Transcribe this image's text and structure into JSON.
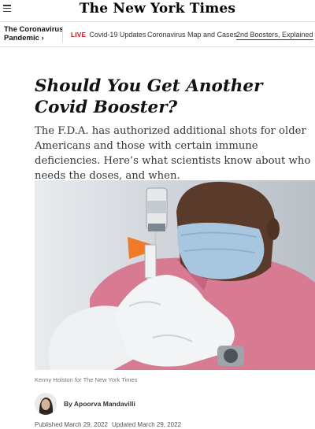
{
  "header": {
    "logo_text": "The New York Times",
    "menu_icon": "hamburger-menu-icon"
  },
  "nav": {
    "section_title_line1": "The Coronavirus",
    "section_title_line2": "Pandemic ›",
    "live_label": "LIVE",
    "items": [
      "Covid-19 Updates",
      "Coronavirus Map and Cases",
      "2nd Boosters, Explained"
    ]
  },
  "article": {
    "headline": "Should You Get Another Covid Booster?",
    "summary": "The F.D.A. has authorized additional shots for older Americans and those with certain immune deficiencies. Here’s what scientists know about who needs the doses, and when.",
    "photo_credit": "Kenny Holston for The New York Times",
    "byline": "By Apoorva Mandavilli",
    "published": "Published March 29, 2022",
    "updated": "Updated March 29, 2022"
  },
  "colors": {
    "live_red": "#d0021b",
    "shirt_pink": "#d97a93",
    "glove_white": "#eef0f2",
    "syringe_orange": "#f07a2a"
  }
}
